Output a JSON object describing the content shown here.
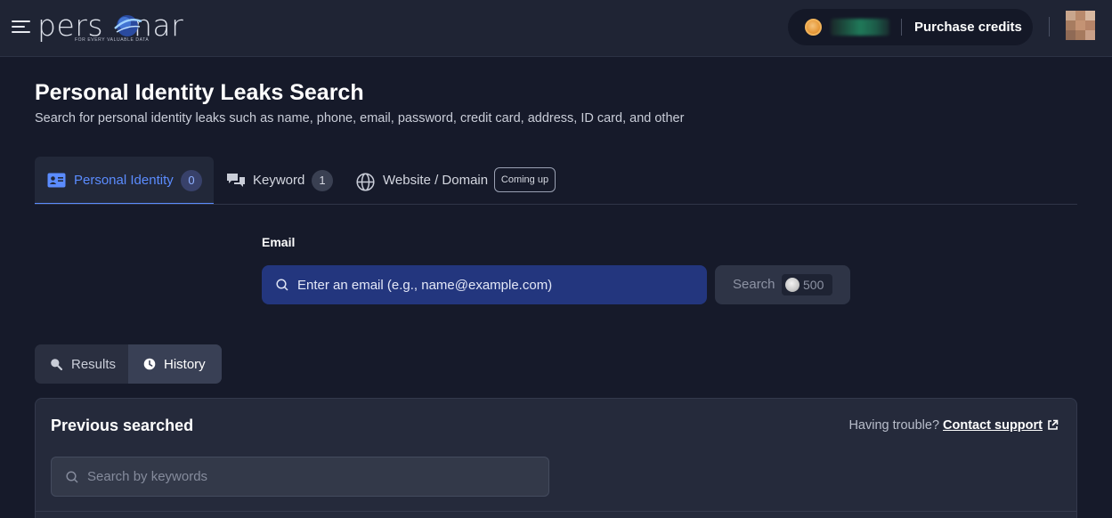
{
  "header": {
    "logo_text": "pers nar",
    "logo_tagline": "FOR EVERY VALUABLE DATA",
    "purchase_label": "Purchase credits",
    "colors": {
      "background": "#1f2434",
      "coin": "#e79a3b"
    },
    "icons": {
      "menu": "hamburger-icon",
      "coin": "coin-icon",
      "avatar": "avatar-image"
    }
  },
  "page": {
    "title": "Personal Identity Leaks Search",
    "subtitle": "Search for personal identity leaks such as name, phone, email, password, credit card, address, ID card, and other"
  },
  "tabs": [
    {
      "label": "Personal Identity",
      "badge": "0",
      "icon": "id-card-icon",
      "active": true
    },
    {
      "label": "Keyword",
      "badge": "1",
      "icon": "chat-bubbles-icon",
      "active": false
    },
    {
      "label": "Website / Domain",
      "badge": "Coming up",
      "icon": "globe-icon",
      "active": false
    }
  ],
  "search": {
    "field_label": "Email",
    "placeholder": "Enter an email (e.g., name@example.com)",
    "button_label": "Search",
    "cost": "500",
    "colors": {
      "input_bg": "#23367e",
      "accent": "#5b8cff"
    }
  },
  "view_toggle": {
    "results_label": "Results",
    "history_label": "History",
    "selected": "History"
  },
  "history": {
    "title": "Previous searched",
    "trouble_text": "Having trouble?",
    "contact_label": "Contact support",
    "search_placeholder": "Search by keywords"
  }
}
